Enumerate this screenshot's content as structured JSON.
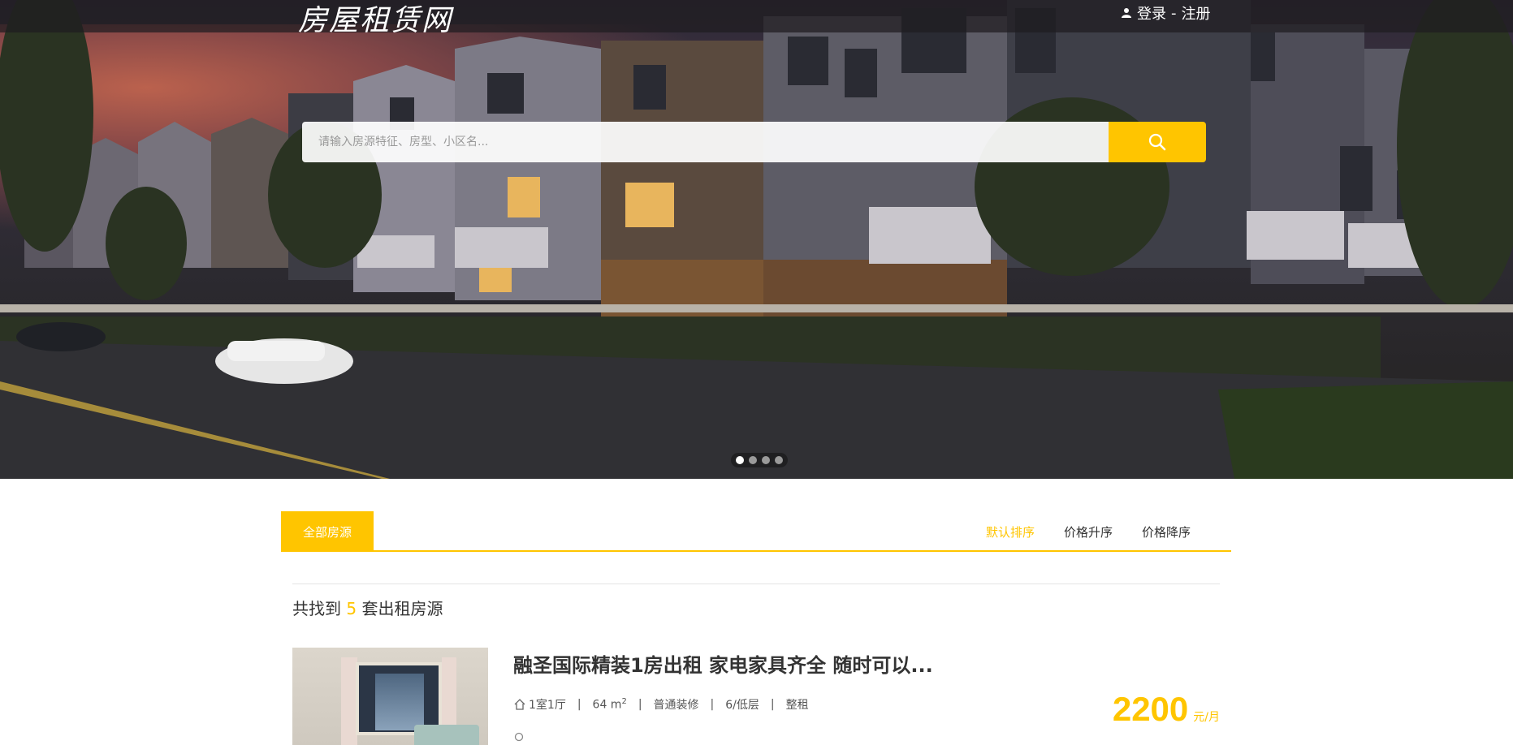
{
  "header": {
    "logo": "房屋租赁网",
    "login": "登录",
    "separator": "-",
    "register": "注册"
  },
  "search": {
    "placeholder": "请输入房源特征、房型、小区名..."
  },
  "carousel": {
    "slides": 4,
    "active_index": 0
  },
  "tabs": {
    "all": "全部房源",
    "sort": [
      {
        "label": "默认排序",
        "active": true
      },
      {
        "label": "价格升序",
        "active": false
      },
      {
        "label": "价格降序",
        "active": false
      }
    ]
  },
  "result": {
    "prefix": "共找到",
    "count": "5",
    "suffix": "套出租房源"
  },
  "listings": [
    {
      "title": "融圣国际精装1房出租 家电家具齐全 随时可以...",
      "layout": "1室1厅",
      "area": "64 m",
      "area_sup": "2",
      "decoration": "普通装修",
      "floor": "6/低层",
      "rent_type": "整租",
      "price": "2200",
      "price_unit": "元/月"
    }
  ],
  "colors": {
    "accent": "#ffc500"
  }
}
